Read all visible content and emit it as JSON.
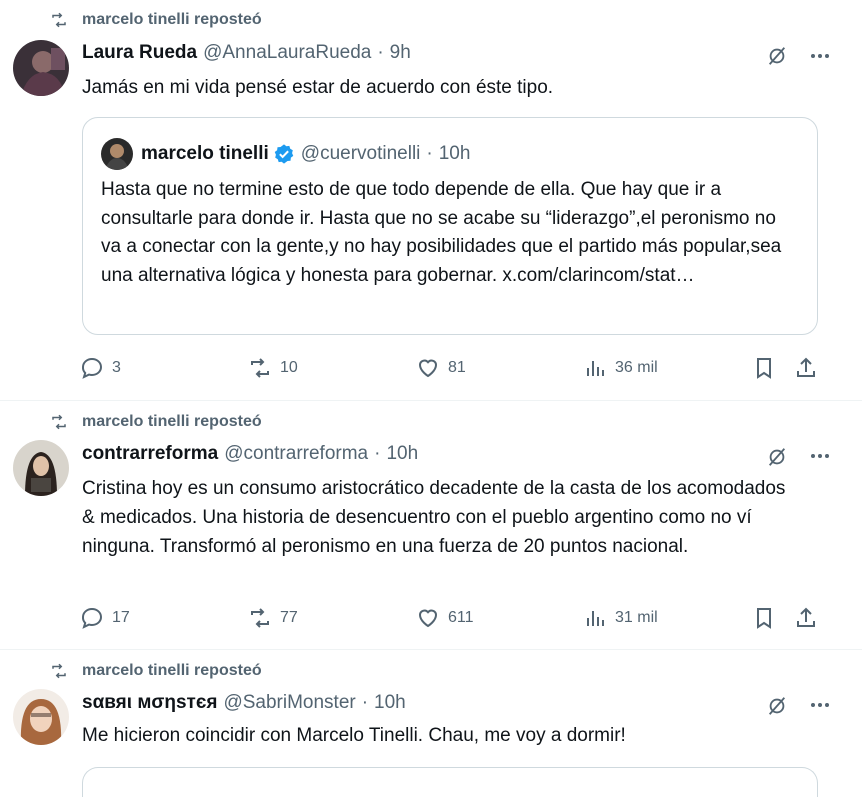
{
  "tweets": [
    {
      "repost_label": "marcelo tinelli reposteó",
      "name": "Laura Rueda",
      "handle": "@AnnaLauraRueda",
      "time": "9h",
      "text": "Jamás en mi vida pensé estar de acuerdo con éste tipo.",
      "quote": {
        "name": "marcelo tinelli",
        "handle": "@cuervotinelli",
        "time": "10h",
        "text": "Hasta que no termine esto de que todo depende de ella. Que hay que ir a consultarle para donde ir. Hasta que no se acabe su “liderazgo”,el peronismo no va a conectar con la gente,y no hay posibilidades que el partido más popular,sea una alternativa lógica y honesta para gobernar. x.com/clarincom/stat…"
      },
      "replies": "3",
      "reposts": "10",
      "likes": "81",
      "views": "36 mil"
    },
    {
      "repost_label": "marcelo tinelli reposteó",
      "name": "contrarreforma",
      "handle": "@contrarreforma",
      "time": "10h",
      "text": "Cristina hoy es un consumo aristocrático decadente de la casta de los acomodados & medicados. Una historia de desencuentro con el pueblo argentino como no ví ninguna. Transformó al peronismo en una fuerza de 20 puntos nacional.",
      "replies": "17",
      "reposts": "77",
      "likes": "611",
      "views": "31 mil"
    },
    {
      "repost_label": "marcelo tinelli reposteó",
      "name": "ѕαвяι мσηѕтєя",
      "handle": "@SabriMonster",
      "time": "10h",
      "text": "Me hicieron coincidir con Marcelo Tinelli. Chau, me voy a dormir!"
    }
  ],
  "colors": {
    "muted": "#536471",
    "text": "#0f1419",
    "border": "#cfd9de",
    "verified": "#1d9bf0"
  },
  "icons": [
    "repost-icon",
    "grok-icon",
    "more-icon",
    "reply-icon",
    "like-icon",
    "views-icon",
    "bookmark-icon",
    "share-icon",
    "verified-badge-icon"
  ]
}
